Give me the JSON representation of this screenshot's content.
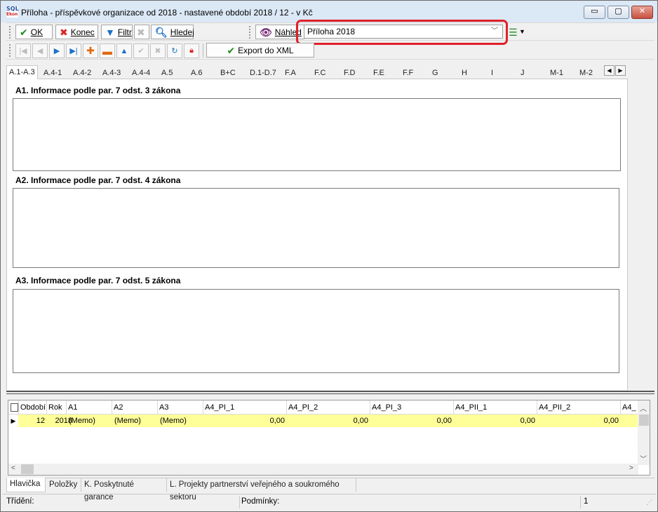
{
  "window": {
    "title": "Příloha - příspěvkové organizace od 2018 - nastavené období 2018 / 12 - v Kč",
    "logo_lines": [
      "SQL",
      "Ekon"
    ],
    "min_glyph": "▭",
    "max_glyph": "▢",
    "close_glyph": "✕"
  },
  "toolbar": {
    "ok_label": "OK",
    "ok_icon": "check-icon",
    "konec_label": "Konec",
    "filtr_label": "Filtr",
    "hledej_label": "Hledej",
    "nahled_label": "Náhled",
    "export_label": "Export do XML"
  },
  "report_select": {
    "value": "Příloha 2018"
  },
  "tabs": [
    "A.1-A.3",
    "A.4-1",
    "A.4-2",
    "A.4-3",
    "A.4-4",
    "A.5",
    "A.6",
    "B+C",
    "D.1-D.7",
    "F.A",
    "F.C",
    "F.D",
    "F.E",
    "F.F",
    "G",
    "H",
    "I",
    "J",
    "M-1",
    "M-2"
  ],
  "sections": {
    "a1": "A1. Informace podle par. 7 odst. 3 zákona",
    "a2": "A2. Informace podle par. 7 odst. 4 zákona",
    "a3": "A3. Informace podle par. 7 odst. 5 zákona"
  },
  "grid": {
    "columns": [
      "Období",
      "Rok",
      "A1",
      "A2",
      "A3",
      "A4_PI_1",
      "A4_PI_2",
      "A4_PI_3",
      "A4_PII_1",
      "A4_PII_2",
      "A4_"
    ],
    "row": {
      "obdobi": "12",
      "rok": "2018",
      "a1": "(Memo)",
      "a2": "(Memo)",
      "a3": "(Memo)",
      "a4_pi_1": "0,00",
      "a4_pi_2": "0,00",
      "a4_pi_3": "0,00",
      "a4_pii_1": "0,00",
      "a4_pii_2": "0,00"
    }
  },
  "bottom_tabs": [
    "Hlavička",
    "Položky",
    "K. Poskytnuté garance",
    "L. Projekty partnerství veřejného a soukromého sektoru"
  ],
  "status": {
    "sort_label": "Třídění:",
    "cond_label": "Podmínky:",
    "count": "1"
  },
  "colors": {
    "highlight": "#e0202a",
    "row_bg": "#ffff99",
    "ok_green": "#1f8c1f",
    "cancel_red": "#dd2222"
  }
}
